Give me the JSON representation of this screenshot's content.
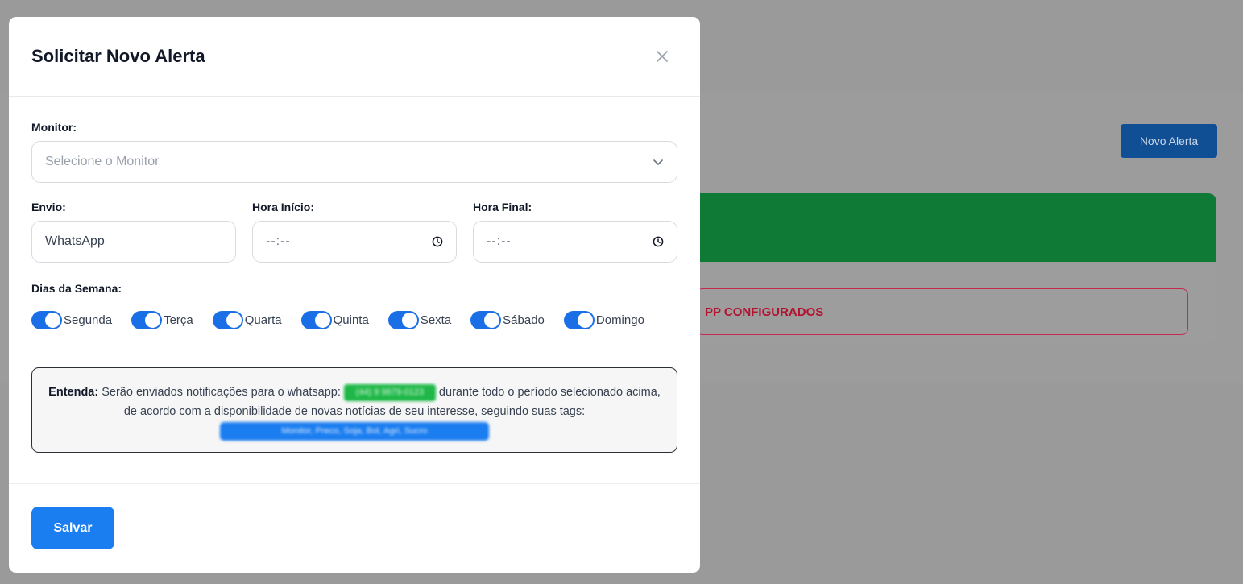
{
  "background": {
    "new_alert_button": "Novo Alerta",
    "alert_text": "PP CONFIGURADOS"
  },
  "modal": {
    "title": "Solicitar Novo Alerta",
    "monitor": {
      "label": "Monitor:",
      "placeholder": "Selecione o Monitor"
    },
    "envio": {
      "label": "Envio:",
      "value": "WhatsApp"
    },
    "hora_inicio": {
      "label": "Hora Início:",
      "value": "--:--"
    },
    "hora_final": {
      "label": "Hora Final:",
      "value": "--:--"
    },
    "dias_label": "Dias da Semana:",
    "days": [
      {
        "label": "Segunda",
        "on": true
      },
      {
        "label": "Terça",
        "on": true
      },
      {
        "label": "Quarta",
        "on": true
      },
      {
        "label": "Quinta",
        "on": true
      },
      {
        "label": "Sexta",
        "on": true
      },
      {
        "label": "Sábado",
        "on": true
      },
      {
        "label": "Domingo",
        "on": true
      }
    ],
    "info": {
      "strong": "Entenda:",
      "text1": " Serão enviados notificações para o whatsapp: ",
      "phone": "(44) 9 9679-0123",
      "text2": " durante todo o período selecionado acima, de acordo com a disponibilidade de novas notícias de seu interesse, seguindo suas tags: ",
      "tags": "Monitor, Preco, Soja, Bol, Agri, Sucro"
    },
    "save_label": "Salvar"
  },
  "colors": {
    "primary": "#1a7df0",
    "toggle": "#1a6fe6",
    "phone_pill": "#1fb848",
    "overlay": "#9a9a9a"
  }
}
